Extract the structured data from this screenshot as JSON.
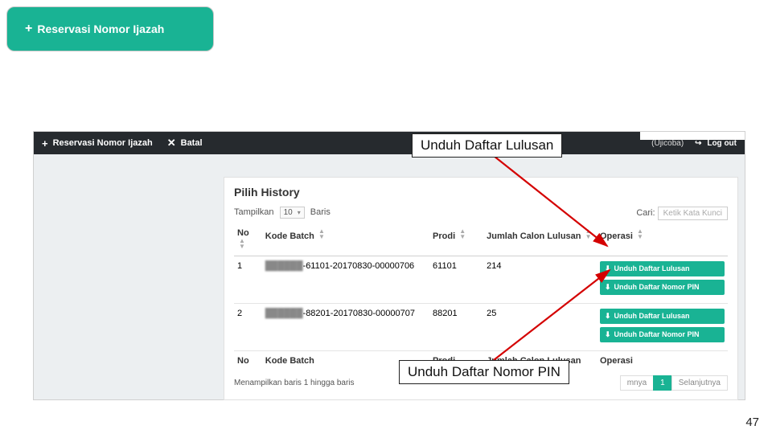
{
  "top_button": {
    "icon": "+",
    "label": "Reservasi Nomor Ijazah"
  },
  "darkbar": {
    "btn1_icon": "+",
    "btn1_label": "Reservasi Nomor Ijazah",
    "btn2_icon": "✕",
    "btn2_label": "Batal",
    "user_label": "(Ujicoba)",
    "logout_icon": "↪",
    "logout_label": "Log out"
  },
  "card": {
    "title": "Pilih History",
    "show_prefix": "Tampilkan",
    "show_value": "10",
    "show_suffix": "Baris",
    "search_label": "Cari:",
    "search_placeholder": "Ketik Kata Kunci"
  },
  "columns": {
    "no": "No",
    "kode": "Kode Batch",
    "prodi": "Prodi",
    "jumlah": "Jumlah Calon Lulusan",
    "operasi": "Operasi"
  },
  "rows": [
    {
      "no": "1",
      "kode_pref": "██████",
      "kode_rest": "-61101-20170830-00000706",
      "prodi": "61101",
      "jumlah": "214",
      "op1": "Unduh Daftar Lulusan",
      "op2": "Unduh Daftar Nomor PIN"
    },
    {
      "no": "2",
      "kode_pref": "██████",
      "kode_rest": "-88201-20170830-00000707",
      "prodi": "88201",
      "jumlah": "25",
      "op1": "Unduh Daftar Lulusan",
      "op2": "Unduh Daftar Nomor PIN"
    }
  ],
  "footer": {
    "info": "Menampilkan baris 1 hingga baris",
    "prev": "mnya",
    "page": "1",
    "next": "Selanjutnya"
  },
  "callouts": {
    "lulusan": "Unduh Daftar Lulusan",
    "pin": "Unduh Daftar Nomor PIN"
  },
  "op_icon": "⬇",
  "page_number": "47"
}
